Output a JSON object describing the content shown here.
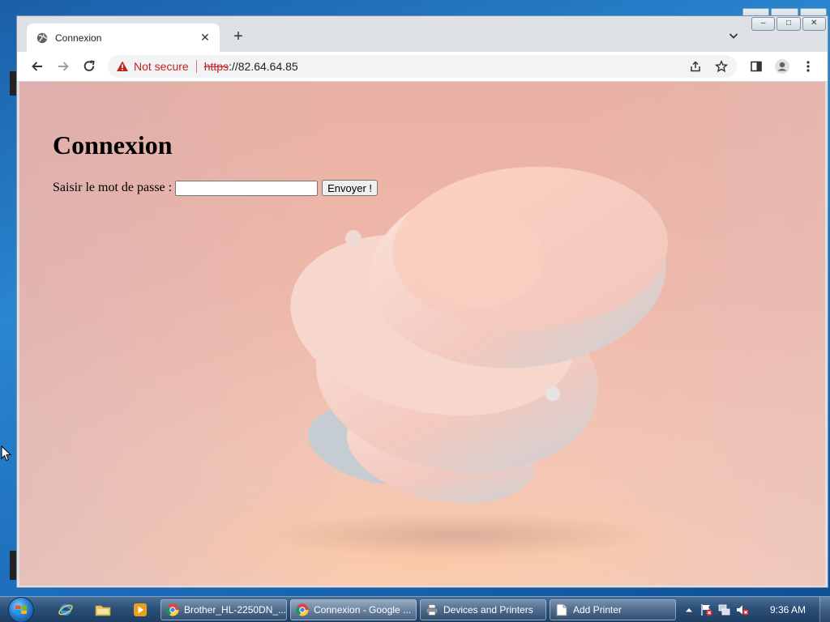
{
  "browser": {
    "tab_title": "Connexion",
    "tab_close_glyph": "✕",
    "new_tab_glyph": "+",
    "omnibox": {
      "security_label": "Not secure",
      "scheme": "https",
      "host": "://82.64.64.85"
    },
    "icons": {
      "back": "back-arrow-icon",
      "forward": "forward-arrow-icon",
      "reload": "reload-icon",
      "warning": "warning-triangle-icon",
      "share": "share-icon",
      "bookmark": "star-icon",
      "side_panel": "side-panel-icon",
      "profile": "profile-icon",
      "menu": "kebab-menu-icon"
    }
  },
  "page": {
    "heading": "Connexion",
    "password_label": "Saisir le mot de passe :",
    "password_value": "",
    "submit_label": "Envoyer !"
  },
  "taskbar": {
    "tasks": [
      {
        "label": "Brother_HL-2250DN_...",
        "icon": "chrome-icon",
        "active": false
      },
      {
        "label": "Connexion - Google ...",
        "icon": "chrome-icon",
        "active": true
      },
      {
        "label": "Devices and Printers",
        "icon": "printer-icon",
        "active": false
      },
      {
        "label": "Add Printer",
        "icon": "document-icon",
        "active": false
      }
    ],
    "clock": "9:36 AM"
  },
  "colors": {
    "accent_warning": "#c5221f",
    "taskbar": "#2c4f78"
  }
}
